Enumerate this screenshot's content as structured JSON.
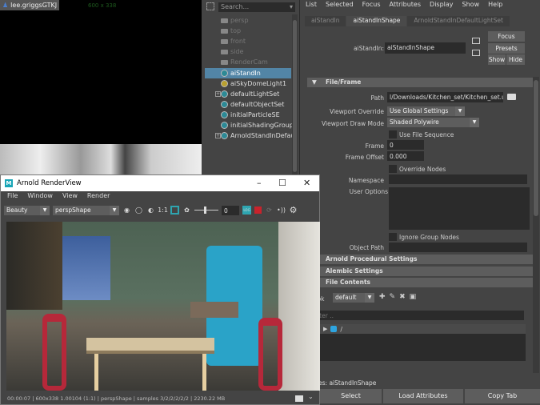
{
  "viewport": {
    "user": "lee.griggsGTKJ",
    "resolution": "600 x 338"
  },
  "outliner": {
    "search_placeholder": "Search...",
    "items": [
      {
        "label": "persp",
        "type": "camera"
      },
      {
        "label": "top",
        "type": "camera"
      },
      {
        "label": "front",
        "type": "camera"
      },
      {
        "label": "side",
        "type": "camera"
      },
      {
        "label": "RenderCam",
        "type": "camera"
      },
      {
        "label": "aiStandIn",
        "type": "standin",
        "selected": true
      },
      {
        "label": "aiSkyDomeLight1",
        "type": "light"
      },
      {
        "label": "defaultLightSet",
        "type": "set",
        "expandable": true
      },
      {
        "label": "defaultObjectSet",
        "type": "set"
      },
      {
        "label": "initialParticleSE",
        "type": "set"
      },
      {
        "label": "initialShadingGroup",
        "type": "set"
      },
      {
        "label": "ArnoldStandInDefaul",
        "type": "set",
        "expandable": true
      }
    ]
  },
  "attribute_editor": {
    "menu": [
      "List",
      "Selected",
      "Focus",
      "Attributes",
      "Display",
      "Show",
      "Help"
    ],
    "tabs": [
      "aiStandIn",
      "aiStandInShape",
      "ArnoldStandInDefaultLightSet"
    ],
    "node_label": "aiStandIn:",
    "node_value": "aiStandInShape",
    "buttons": {
      "focus": "Focus",
      "presets": "Presets",
      "show": "Show",
      "hide": "Hide"
    },
    "file_frame": {
      "title": "File/Frame",
      "path_label": "Path",
      "path_value": "l/Downloads/Kitchen_set/Kitchen_set.usd",
      "viewport_override_label": "Viewport Override",
      "viewport_override_value": "Use Global Settings",
      "viewport_draw_label": "Viewport Draw Mode",
      "viewport_draw_value": "Shaded Polywire",
      "use_file_sequence": "Use File Sequence",
      "frame_label": "Frame",
      "frame_value": "0",
      "frame_offset_label": "Frame Offset",
      "frame_offset_value": "0.000",
      "override_nodes": "Override Nodes",
      "namespace_label": "Namespace",
      "user_options_label": "User Options",
      "ignore_group_nodes": "Ignore Group Nodes",
      "object_path_label": "Object Path"
    },
    "sections": [
      "Arnold Procedural Settings",
      "Alembic Settings",
      "File Contents"
    ],
    "lookbook_label": "ook",
    "lookbook_value": "default",
    "filter_placeholder": "ilter ..",
    "tree_root": "/",
    "nodes_label": "es:",
    "nodes_value": "aiStandInShape",
    "bottom": [
      "Select",
      "Load Attributes",
      "Copy Tab"
    ]
  },
  "renderview": {
    "title": "Arnold RenderView",
    "menu": [
      "File",
      "Window",
      "View",
      "Render"
    ],
    "aov": "Beauty",
    "camera": "perspShape",
    "ratio": "1:1",
    "exposure": "0",
    "status": "00:00:07 | 600x338 1.00104 (1:1) | perspShape  | samples 3/2/2/2/2/2 | 2230.22 MB"
  },
  "colors": {
    "selection": "#5285a6",
    "stop": "#c8232c",
    "accent": "#2d8a96"
  }
}
